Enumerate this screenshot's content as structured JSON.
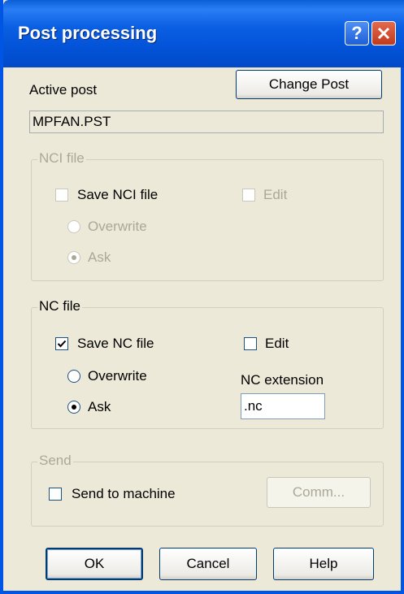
{
  "window": {
    "title": "Post processing",
    "help_glyph": "?",
    "close_icon": "close-icon"
  },
  "active_post": {
    "label": "Active post",
    "value": "MPFAN.PST",
    "change_button": "Change Post"
  },
  "nci_group": {
    "title": "NCI file",
    "save_label": "Save NCI file",
    "save_checked": false,
    "edit_label": "Edit",
    "edit_checked": false,
    "overwrite_label": "Overwrite",
    "ask_label": "Ask",
    "selected": "Ask",
    "enabled": false
  },
  "nc_group": {
    "title": "NC file",
    "save_label": "Save NC file",
    "save_checked": true,
    "edit_label": "Edit",
    "edit_checked": false,
    "overwrite_label": "Overwrite",
    "ask_label": "Ask",
    "selected": "Ask",
    "extension_label": "NC extension",
    "extension_value": ".nc"
  },
  "send_group": {
    "title": "Send",
    "send_label": "Send to machine",
    "send_checked": false,
    "comm_button": "Comm...",
    "enabled": false
  },
  "buttons": {
    "ok": "OK",
    "cancel": "Cancel",
    "help": "Help"
  },
  "colors": {
    "title_blue": "#0a5fd8",
    "dialog_bg": "#ece9d8",
    "close_red": "#c13a1d",
    "disabled_text": "#aca899"
  }
}
